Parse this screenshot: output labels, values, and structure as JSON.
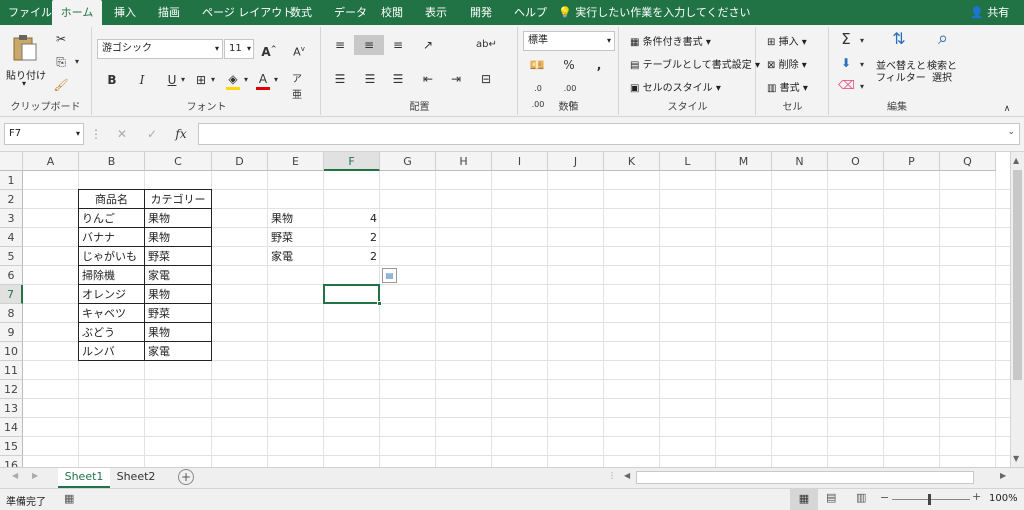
{
  "tabs": [
    "ファイル",
    "ホーム",
    "挿入",
    "描画",
    "ページ レイアウト",
    "数式",
    "データ",
    "校閲",
    "表示",
    "開発",
    "ヘルプ"
  ],
  "tell_me": "実行したい作業を入力してください",
  "share": "共有",
  "ribbon": {
    "clipboard": {
      "label": "クリップボード",
      "paste": "貼り付け"
    },
    "font": {
      "label": "フォント",
      "name": "游ゴシック",
      "size": "11",
      "bold": "B",
      "italic": "I",
      "underline": "U"
    },
    "alignment": {
      "label": "配置"
    },
    "number": {
      "label": "数値",
      "format": "標準"
    },
    "styles": {
      "label": "スタイル",
      "conditional": "条件付き書式",
      "table": "テーブルとして書式設定",
      "cell_styles": "セルのスタイル"
    },
    "cells": {
      "label": "セル",
      "insert": "挿入",
      "delete": "削除",
      "format": "書式"
    },
    "editing": {
      "label": "編集",
      "sort": "並べ替えと\nフィルター",
      "find": "検索と\n選択",
      "sigma": "Σ"
    }
  },
  "formula_bar": {
    "name_box": "F7",
    "formula": "",
    "fx": "fx"
  },
  "columns": [
    "A",
    "B",
    "C",
    "D",
    "E",
    "F",
    "G",
    "H",
    "I",
    "J",
    "K",
    "L",
    "M",
    "N",
    "O",
    "P",
    "Q"
  ],
  "rows": [
    "1",
    "2",
    "3",
    "4",
    "5",
    "6",
    "7",
    "8",
    "9",
    "10",
    "11",
    "12",
    "13",
    "14",
    "15",
    "16"
  ],
  "table": {
    "header": [
      "商品名",
      "カテゴリー"
    ],
    "rows": [
      [
        "りんご",
        "果物"
      ],
      [
        "バナナ",
        "果物"
      ],
      [
        "じゃがいも",
        "野菜"
      ],
      [
        "掃除機",
        "家電"
      ],
      [
        "オレンジ",
        "果物"
      ],
      [
        "キャベツ",
        "野菜"
      ],
      [
        "ぶどう",
        "果物"
      ],
      [
        "ルンバ",
        "家電"
      ]
    ]
  },
  "summary": [
    [
      "果物",
      "4"
    ],
    [
      "野菜",
      "2"
    ],
    [
      "家電",
      "2"
    ]
  ],
  "sheets": [
    "Sheet1",
    "Sheet2"
  ],
  "status": {
    "ready": "準備完了",
    "zoom": "100%"
  },
  "colors": {
    "accent": "#217346",
    "selection": "#217346"
  }
}
